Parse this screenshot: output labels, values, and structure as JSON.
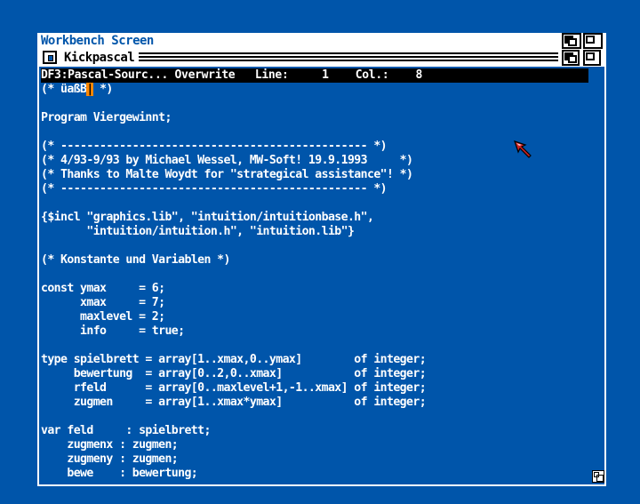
{
  "screen": {
    "title": "Workbench Screen"
  },
  "window": {
    "title": "Kickpascal",
    "status_line": "DF3:Pascal-Sourc... Overwrite   Line:     1    Col.:    8"
  },
  "editor": {
    "cursor_char": "|",
    "lines": [
      "(* üaßB",
      "",
      "Program Viergewinnt;",
      "",
      "(* ----------------------------------------------- *)",
      "(* 4/93-9/93 by Michael Wessel, MW-Soft! 19.9.1993     *)",
      "(* Thanks to Malte Woydt for \"strategical assistance\"! *)",
      "(* ----------------------------------------------- *)",
      "",
      "{$incl \"graphics.lib\", \"intuition/intuitionbase.h\",",
      "       \"intuition/intuition.h\", \"intuition.lib\"}",
      "",
      "(* Konstante und Variablen *)",
      "",
      "const ymax     = 6;",
      "      xmax     = 7;",
      "      maxlevel = 2;",
      "      info     = true;",
      "",
      "type spielbrett = array[1..xmax,0..ymax]        of integer;",
      "     bewertung  = array[0..2,0..xmax]           of integer;",
      "     rfeld      = array[0..maxlevel+1,-1..xmax] of integer;",
      "     zugmen     = array[1..xmax*ymax]           of integer;",
      "",
      "var feld     : spielbrett;",
      "    zugmenx : zugmen;",
      "    zugmeny : zugmen;",
      "    bewe    : bewertung;"
    ]
  },
  "colors": {
    "background": "#0055aa",
    "foreground": "#ffffff",
    "status_bg": "#000000",
    "cursor": "#ff8800",
    "pointer": "#cc2222"
  },
  "icons": {
    "close": "close-icon",
    "depth": "depth-arrange-icon",
    "resize": "resize-icon",
    "pointer": "mouse-pointer-icon"
  }
}
